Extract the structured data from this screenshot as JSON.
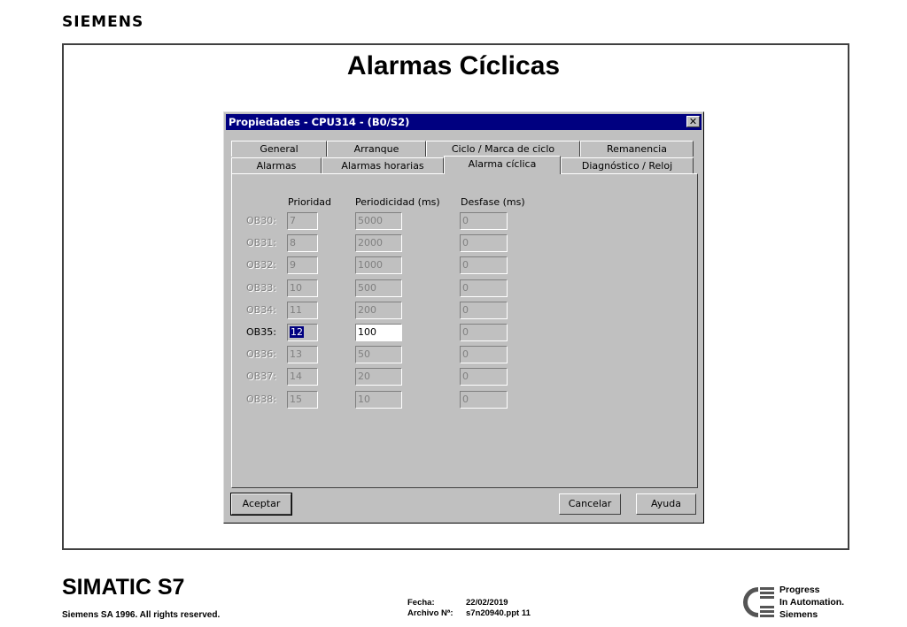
{
  "header": {
    "brand": "SIEMENS"
  },
  "slide": {
    "title": "Alarmas Cíclicas"
  },
  "dialog": {
    "title": "Propiedades - CPU314 - (B0/S2)",
    "close_symbol": "✕",
    "tabs_row1": [
      "General",
      "Arranque",
      "Ciclo / Marca de ciclo",
      "Remanencia"
    ],
    "tabs_row2": [
      "Alarmas",
      "Alarmas horarias",
      "Alarma cíclica",
      "Diagnóstico / Reloj"
    ],
    "active_tab": "Alarma cíclica",
    "columns": {
      "priority": "Prioridad",
      "period": "Periodicidad (ms)",
      "offset": "Desfase (ms)"
    },
    "rows": [
      {
        "label": "OB30:",
        "priority": "7",
        "period": "5000",
        "offset": "0",
        "enabled": false
      },
      {
        "label": "OB31:",
        "priority": "8",
        "period": "2000",
        "offset": "0",
        "enabled": false
      },
      {
        "label": "OB32:",
        "priority": "9",
        "period": "1000",
        "offset": "0",
        "enabled": false
      },
      {
        "label": "OB33:",
        "priority": "10",
        "period": "500",
        "offset": "0",
        "enabled": false
      },
      {
        "label": "OB34:",
        "priority": "11",
        "period": "200",
        "offset": "0",
        "enabled": false
      },
      {
        "label": "OB35:",
        "priority": "12",
        "period": "100",
        "offset": "0",
        "enabled": true
      },
      {
        "label": "OB36:",
        "priority": "13",
        "period": "50",
        "offset": "0",
        "enabled": false
      },
      {
        "label": "OB37:",
        "priority": "14",
        "period": "20",
        "offset": "0",
        "enabled": false
      },
      {
        "label": "OB38:",
        "priority": "15",
        "period": "10",
        "offset": "0",
        "enabled": false
      }
    ],
    "buttons": {
      "ok": "Aceptar",
      "cancel": "Cancelar",
      "help": "Ayuda"
    }
  },
  "footer": {
    "product": "SIMATIC S7",
    "copyright": "Siemens SA 1996. All rights reserved.",
    "date_label": "Fecha:",
    "date_value": "22/02/2019",
    "file_label": "Archivo Nª:",
    "file_value": "s7n20940.ppt 11",
    "slogan": [
      "Progress",
      "In Automation.",
      "Siemens"
    ]
  }
}
